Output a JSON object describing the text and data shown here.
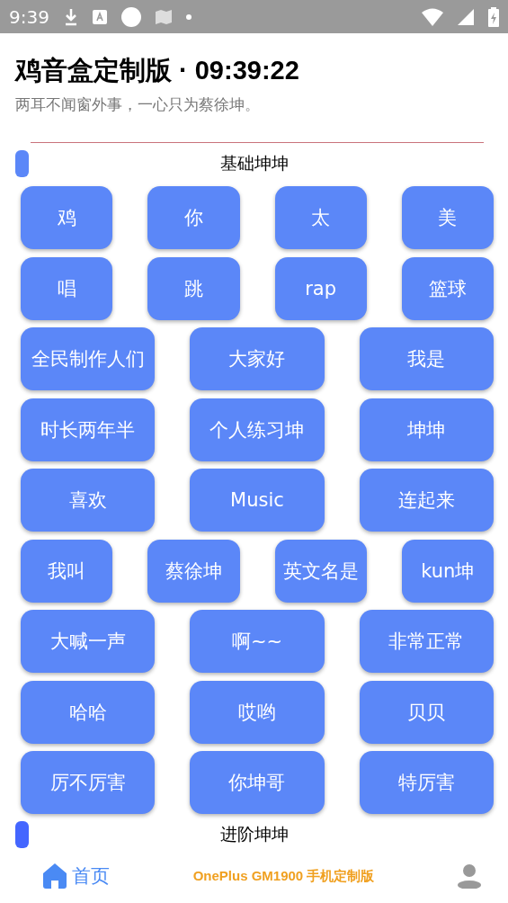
{
  "status_bar": {
    "time": "9:39"
  },
  "header": {
    "title": "鸡音盒定制版",
    "clock": "· 09:39:22",
    "subtitle": "两耳不闻窗外事，一心只为蔡徐坤。"
  },
  "sections": [
    {
      "title": "基础坤坤",
      "color": "#5b87f8",
      "rows": [
        [
          "鸡",
          "你",
          "太",
          "美"
        ],
        [
          "唱",
          "跳",
          "rap",
          "篮球"
        ],
        [
          "全民制作人们",
          "大家好",
          "我是"
        ],
        [
          "时长两年半",
          "个人练习坤",
          "坤坤"
        ],
        [
          "喜欢",
          "Music",
          "连起来"
        ],
        [
          "我叫",
          "蔡徐坤",
          "英文名是",
          "kun坤"
        ],
        [
          "大喊一声",
          "啊~~",
          "非常正常"
        ],
        [
          "哈哈",
          "哎哟",
          "贝贝"
        ],
        [
          "厉不厉害",
          "你坤哥",
          "特厉害"
        ]
      ]
    },
    {
      "title": "进阶坤坤",
      "color": "#4466ff"
    }
  ],
  "bottom_nav": {
    "home": {
      "label": "首页",
      "selected": true
    },
    "center_text": "OnePlus GM1900 手机定制版",
    "profile": {
      "selected": false
    }
  }
}
